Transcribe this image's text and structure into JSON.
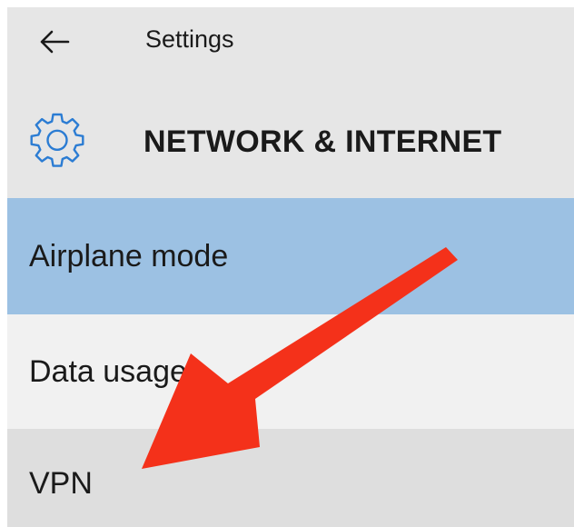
{
  "header": {
    "app_title": "Settings",
    "page_title": "NETWORK & INTERNET",
    "back_icon": "back-arrow-icon",
    "page_icon": "gear-icon"
  },
  "nav": {
    "items": [
      {
        "label": "Airplane mode",
        "state": "selected"
      },
      {
        "label": "Data usage",
        "state": "normal"
      },
      {
        "label": "VPN",
        "state": "hover"
      }
    ]
  },
  "annotation": {
    "icon": "red-pointer-arrow-icon",
    "color": "#f4311a"
  },
  "colors": {
    "header_bg": "#e6e6e6",
    "selected_bg": "#9cc1e3",
    "item_bg": "#f1f1f1",
    "hover_bg": "#dedede",
    "accent": "#2b7cd3"
  }
}
